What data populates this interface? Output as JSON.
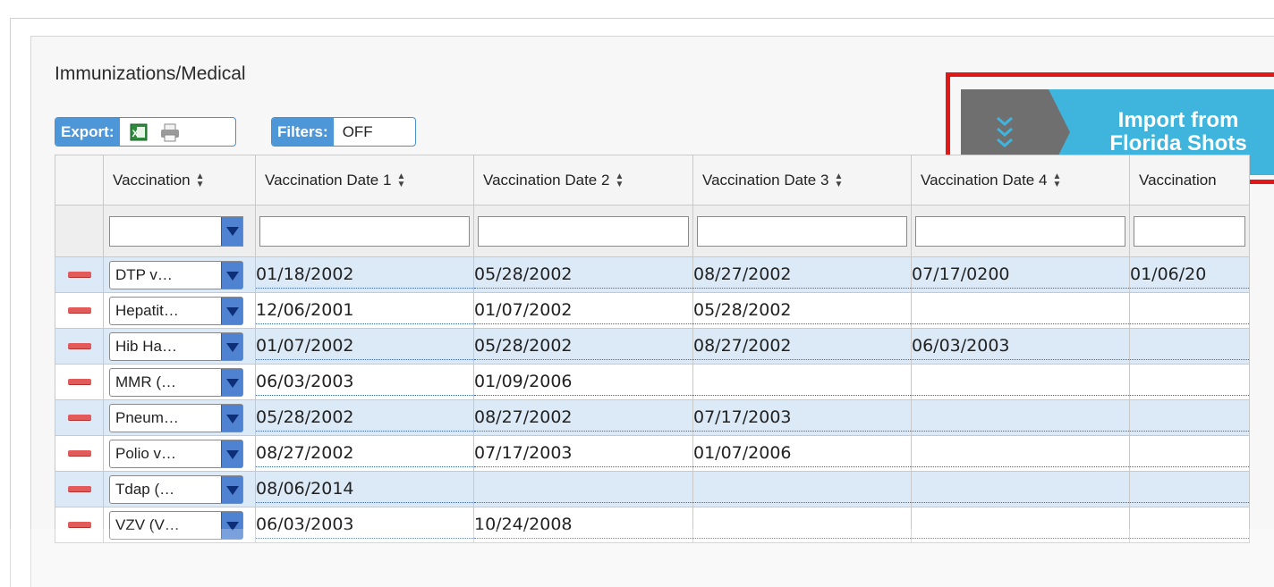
{
  "panel": {
    "title": "Immunizations/Medical"
  },
  "toolbar": {
    "export_label": "Export:",
    "filters_label": "Filters:",
    "filters_value": "OFF"
  },
  "import_button": {
    "label_line1": "Import from",
    "label_line2": "Florida Shots"
  },
  "columns": [
    "Vaccination",
    "Vaccination Date 1",
    "Vaccination Date 2",
    "Vaccination Date 3",
    "Vaccination Date 4",
    "Vaccination"
  ],
  "rows": [
    {
      "vaccine": "DTP v…",
      "dates": [
        "01/18/2002",
        "05/28/2002",
        "08/27/2002",
        "07/17/0200",
        "01/06/20"
      ]
    },
    {
      "vaccine": "Hepatit…",
      "dates": [
        "12/06/2001",
        "01/07/2002",
        "05/28/2002",
        "",
        ""
      ]
    },
    {
      "vaccine": "Hib Ha…",
      "dates": [
        "01/07/2002",
        "05/28/2002",
        "08/27/2002",
        "06/03/2003",
        ""
      ]
    },
    {
      "vaccine": "MMR (…",
      "dates": [
        "06/03/2003",
        "01/09/2006",
        "",
        "",
        ""
      ]
    },
    {
      "vaccine": "Pneum…",
      "dates": [
        "05/28/2002",
        "08/27/2002",
        "07/17/2003",
        "",
        ""
      ]
    },
    {
      "vaccine": "Polio v…",
      "dates": [
        "08/27/2002",
        "07/17/2003",
        "01/07/2006",
        "",
        ""
      ]
    },
    {
      "vaccine": "Tdap (…",
      "dates": [
        "08/06/2014",
        "",
        "",
        "",
        ""
      ]
    },
    {
      "vaccine": "VZV (V…",
      "dates": [
        "06/03/2003",
        "10/24/2008",
        "",
        "",
        ""
      ]
    }
  ],
  "colors": {
    "accent": "#3fb5dd",
    "highlight_border": "#e01818",
    "row_alt": "#dce9f7",
    "delete": "#e25a5a"
  }
}
